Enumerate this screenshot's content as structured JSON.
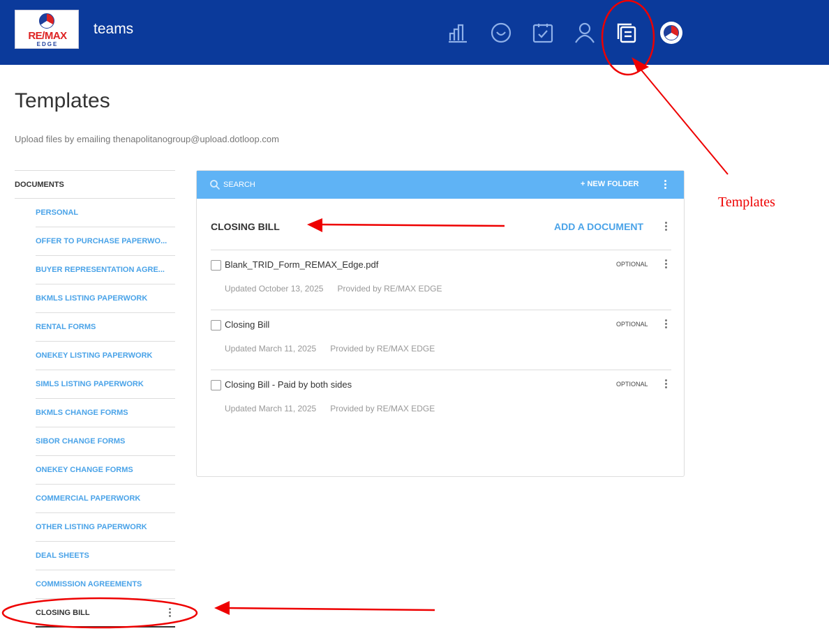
{
  "header": {
    "logo_text": "RE/MAX",
    "logo_sub": "EDGE",
    "app_title": "teams",
    "nav_icons": [
      "bar-chart-icon",
      "smiley-icon",
      "checklist-icon",
      "person-icon",
      "templates-icon",
      "profile-avatar"
    ]
  },
  "page": {
    "title": "Templates",
    "upload_note": "Upload files by emailing thenapolitanogroup@upload.dotloop.com"
  },
  "sidebar": {
    "heading": "DOCUMENTS",
    "items": [
      {
        "label": "PERSONAL"
      },
      {
        "label": "OFFER TO PURCHASE PAPERWO..."
      },
      {
        "label": "BUYER REPRESENTATION AGRE..."
      },
      {
        "label": "BKMLS LISTING PAPERWORK"
      },
      {
        "label": "RENTAL FORMS"
      },
      {
        "label": "ONEKEY LISTING PAPERWORK"
      },
      {
        "label": "SIMLS LISTING PAPERWORK"
      },
      {
        "label": "BKMLS CHANGE FORMS"
      },
      {
        "label": "SIBOR CHANGE FORMS"
      },
      {
        "label": "ONEKEY CHANGE FORMS"
      },
      {
        "label": "COMMERCIAL PAPERWORK"
      },
      {
        "label": "OTHER LISTING PAPERWORK"
      },
      {
        "label": "DEAL SHEETS"
      },
      {
        "label": "COMMISSION AGREEMENTS"
      },
      {
        "label": "CLOSING BILL",
        "active": true
      }
    ]
  },
  "panel": {
    "search_label": "SEARCH",
    "new_folder_label": "+ NEW FOLDER",
    "folder_name": "CLOSING BILL",
    "add_document_label": "ADD A DOCUMENT",
    "documents": [
      {
        "name": "Blank_TRID_Form_REMAX_Edge.pdf",
        "updated": "Updated October 13, 2025",
        "provider": "Provided by RE/MAX EDGE",
        "tag": "OPTIONAL"
      },
      {
        "name": "Closing Bill",
        "updated": "Updated March 11, 2025",
        "provider": "Provided by RE/MAX EDGE",
        "tag": "OPTIONAL"
      },
      {
        "name": "Closing Bill - Paid by both sides",
        "updated": "Updated March 11, 2025",
        "provider": "Provided by RE/MAX EDGE",
        "tag": "OPTIONAL"
      }
    ]
  },
  "annotation": {
    "label": "Templates",
    "color": "#e00000"
  },
  "colors": {
    "header_bg": "#0b3a9b",
    "accent": "#4aa3e8",
    "search_bar": "#5fb3f5"
  }
}
